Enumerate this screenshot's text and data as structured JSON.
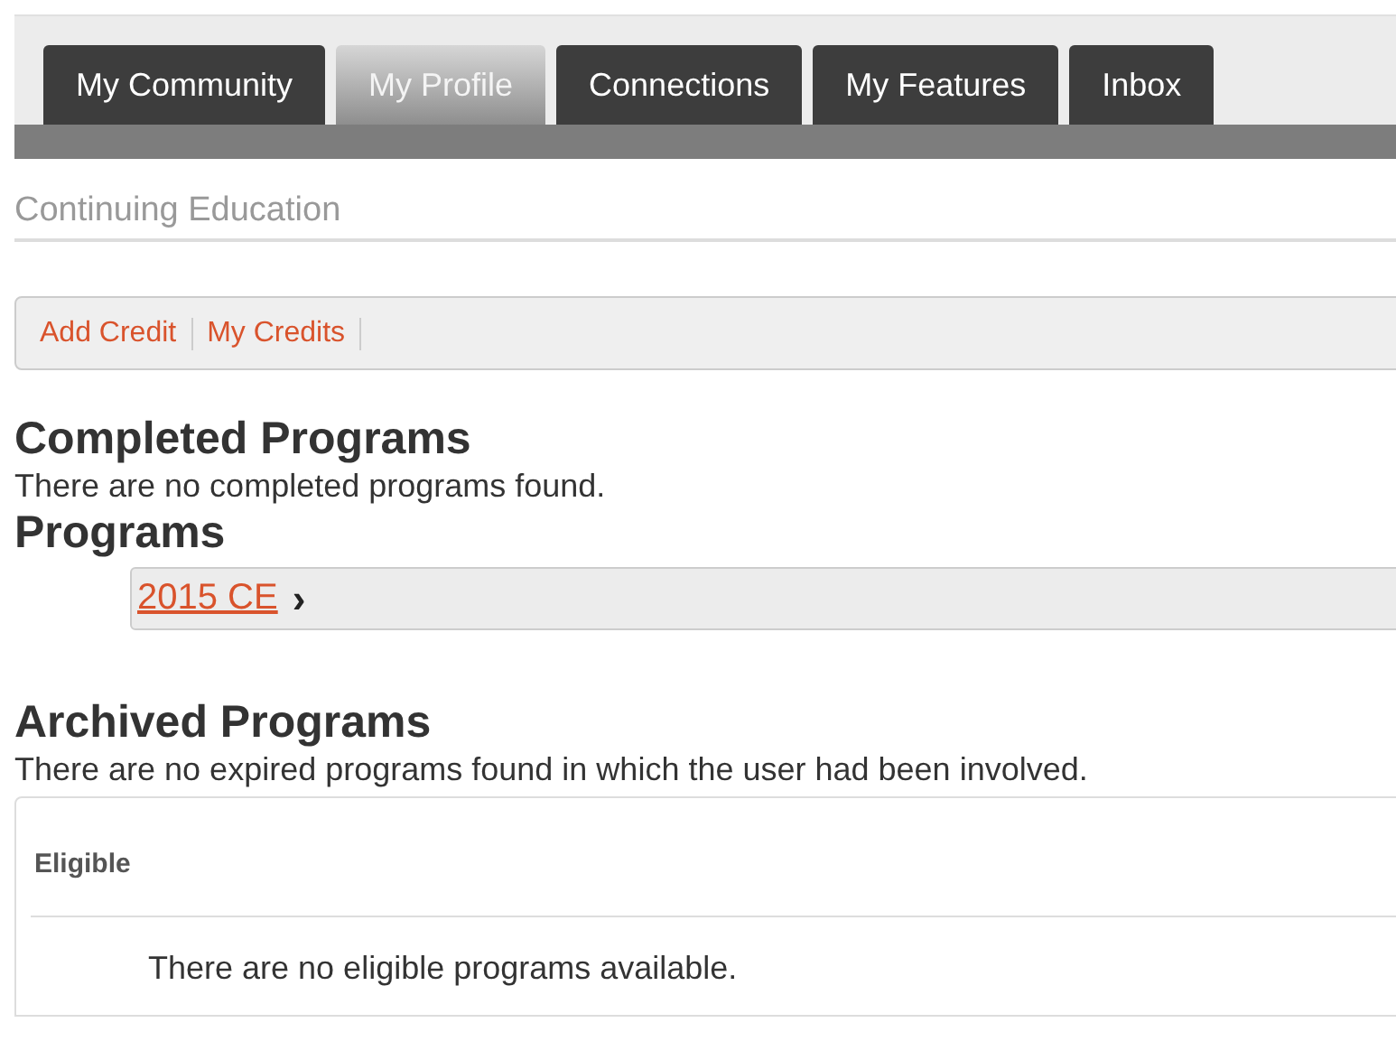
{
  "tabs": [
    {
      "label": "My Community",
      "selected": false
    },
    {
      "label": "My Profile",
      "selected": true
    },
    {
      "label": "Connections",
      "selected": false
    },
    {
      "label": "My Features",
      "selected": false
    },
    {
      "label": "Inbox",
      "selected": false
    }
  ],
  "page_title": "Continuing Education",
  "toolbar_links": [
    "Add Credit",
    "My Credits"
  ],
  "completed": {
    "heading": "Completed Programs",
    "message": "There are no completed programs found."
  },
  "programs": {
    "heading": "Programs",
    "items": [
      {
        "label": "2015 CE",
        "arrow": "›"
      }
    ]
  },
  "archived": {
    "heading": "Archived Programs",
    "message": "There are no expired programs found in which the user had been involved."
  },
  "eligible": {
    "heading": "Eligible",
    "message": "There are no eligible programs available."
  }
}
